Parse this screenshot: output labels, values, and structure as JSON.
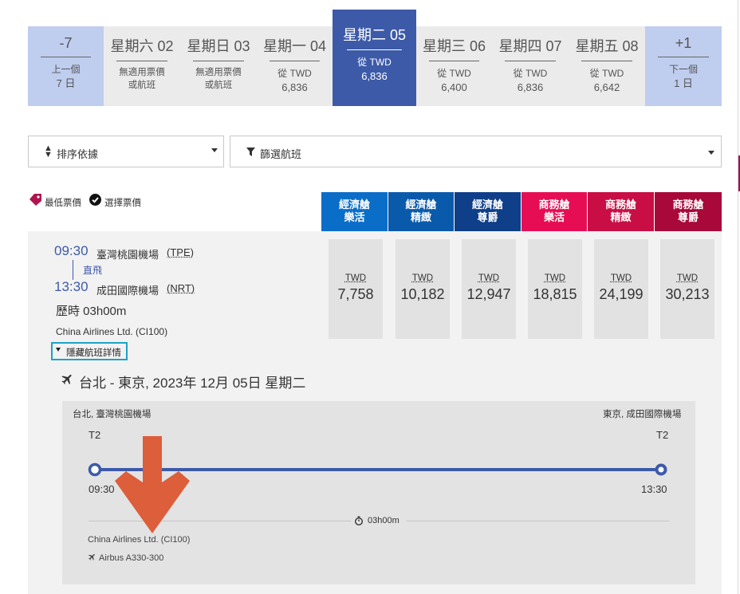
{
  "top_caption": "2023年 12月",
  "date_strip": [
    {
      "day": "-7",
      "line1": "上一個",
      "line2": "7 日",
      "kind": "nav"
    },
    {
      "day": "星期六 02",
      "line1": "無適用票價",
      "line2": "或航班",
      "kind": "na"
    },
    {
      "day": "星期日 03",
      "line1": "無適用票價",
      "line2": "或航班",
      "kind": "na"
    },
    {
      "day": "星期一 04",
      "line1": "從 TWD",
      "line2": "6,836",
      "kind": "price"
    },
    {
      "day": "星期二 05",
      "line1": "從 TWD",
      "line2": "6,836",
      "kind": "selected"
    },
    {
      "day": "星期三 06",
      "line1": "從 TWD",
      "line2": "6,400",
      "kind": "price"
    },
    {
      "day": "星期四 07",
      "line1": "從 TWD",
      "line2": "6,836",
      "kind": "price"
    },
    {
      "day": "星期五 08",
      "line1": "從 TWD",
      "line2": "6,642",
      "kind": "price"
    },
    {
      "day": "+1",
      "line1": "下一個",
      "line2": "1 日",
      "kind": "nav"
    }
  ],
  "sort": {
    "label": "排序依據"
  },
  "filter": {
    "label": "篩選航班"
  },
  "legend": {
    "lowest": "最低票價",
    "selected": "選擇票價"
  },
  "cabins": [
    {
      "line1": "經濟艙",
      "line2": "樂活",
      "color": "#0a6ec8"
    },
    {
      "line1": "經濟艙",
      "line2": "精緻",
      "color": "#0a5aac"
    },
    {
      "line1": "經濟艙",
      "line2": "尊爵",
      "color": "#0e3f88"
    },
    {
      "line1": "商務艙",
      "line2": "樂活",
      "color": "#e60d54"
    },
    {
      "line1": "商務艙",
      "line2": "精緻",
      "color": "#c90e45"
    },
    {
      "line1": "商務艙",
      "line2": "尊爵",
      "color": "#a8093a"
    }
  ],
  "flight": {
    "dep_time": "09:30",
    "dep_airport": "臺灣桃園機場",
    "dep_code": "(TPE)",
    "stops": "直飛",
    "arr_time": "13:30",
    "arr_airport": "成田國際機場",
    "arr_code": "(NRT)",
    "duration": "歷時 03h00m",
    "carrier": "China Airlines Ltd. (CI100)",
    "toggle": "隱藏航班詳情",
    "prices": [
      {
        "currency": "TWD",
        "amount": "7,758"
      },
      {
        "currency": "TWD",
        "amount": "10,182"
      },
      {
        "currency": "TWD",
        "amount": "12,947"
      },
      {
        "currency": "TWD",
        "amount": "18,815"
      },
      {
        "currency": "TWD",
        "amount": "24,199"
      },
      {
        "currency": "TWD",
        "amount": "30,213"
      }
    ]
  },
  "details": {
    "route_title": "台北 - 東京, 2023年 12月 05日 星期二",
    "origin": "台北, 臺灣桃園機場",
    "destination": "東京, 成田國際機場",
    "origin_terminal": "T2",
    "dest_terminal": "T2",
    "dep_time": "09:30",
    "arr_time": "13:30",
    "duration": "03h00m",
    "carrier": "China Airlines Ltd. (CI100)",
    "aircraft": "Airbus A330-300"
  },
  "colors": {
    "selected_day": "#3d5aa8",
    "nav_day": "#bfcdef",
    "timeline": "#3d5aa8",
    "annotation_arrow": "#dd5e3a",
    "brand_magenta": "#9b1159"
  }
}
